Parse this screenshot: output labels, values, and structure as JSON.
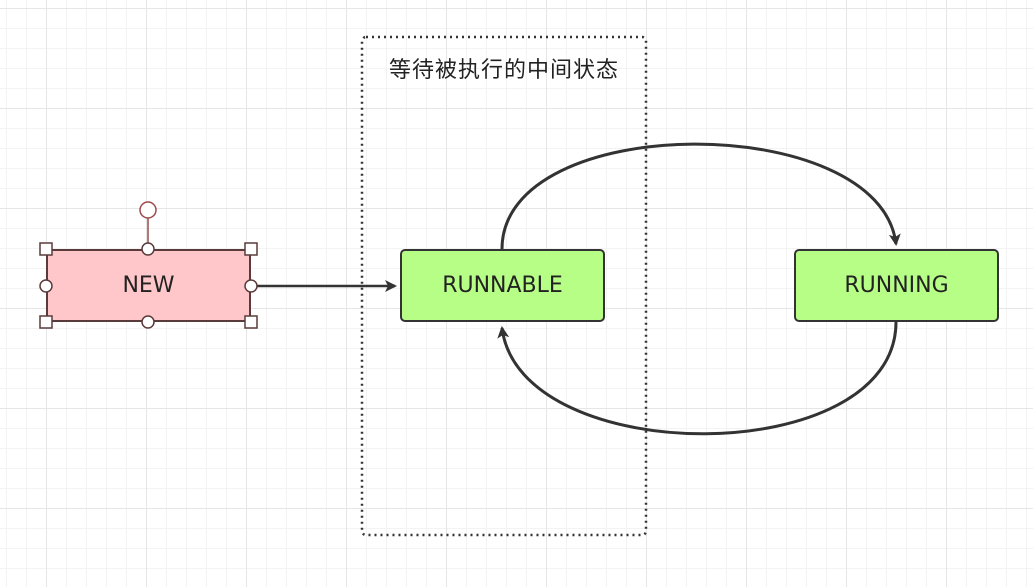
{
  "group": {
    "label": "等待被执行的中间状态"
  },
  "nodes": {
    "new": {
      "label": "NEW"
    },
    "runnable": {
      "label": "RUNNABLE"
    },
    "running": {
      "label": "RUNNING"
    }
  },
  "colors": {
    "new_fill": "#ffc7c9",
    "new_border": "#5a3b3b",
    "state_fill": "#b7fe87",
    "edge": "#333333",
    "handle": "#9b4b4b"
  }
}
